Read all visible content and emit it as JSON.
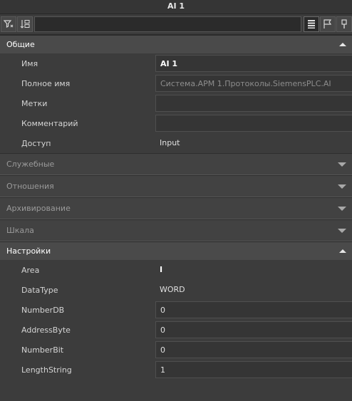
{
  "window": {
    "title": "AI 1"
  },
  "toolbar": {
    "left_buttons": [
      "filter-icon",
      "sort-icon"
    ],
    "right_buttons": [
      "list-view-icon",
      "flag-icon",
      "pin-icon"
    ]
  },
  "sections": {
    "general": {
      "title": "Общие",
      "rows": [
        {
          "label": "Имя",
          "value": "AI 1"
        },
        {
          "label": "Полное имя",
          "value": "Система.АРМ 1.Протоколы.SiemensPLC.AI"
        },
        {
          "label": "Метки",
          "value": ""
        },
        {
          "label": "Комментарий",
          "value": ""
        },
        {
          "label": "Доступ",
          "value": "Input"
        }
      ]
    },
    "service": {
      "title": "Служебные"
    },
    "relations": {
      "title": "Отношения"
    },
    "archiving": {
      "title": "Архивирование"
    },
    "scale": {
      "title": "Шкала"
    },
    "settings": {
      "title": "Настройки",
      "rows": [
        {
          "label": "Area",
          "value": "I"
        },
        {
          "label": "DataType",
          "value": "WORD"
        },
        {
          "label": "NumberDB",
          "value": "0"
        },
        {
          "label": "AddressByte",
          "value": "0"
        },
        {
          "label": "NumberBit",
          "value": "0"
        },
        {
          "label": "LengthString",
          "value": "1"
        }
      ]
    }
  }
}
